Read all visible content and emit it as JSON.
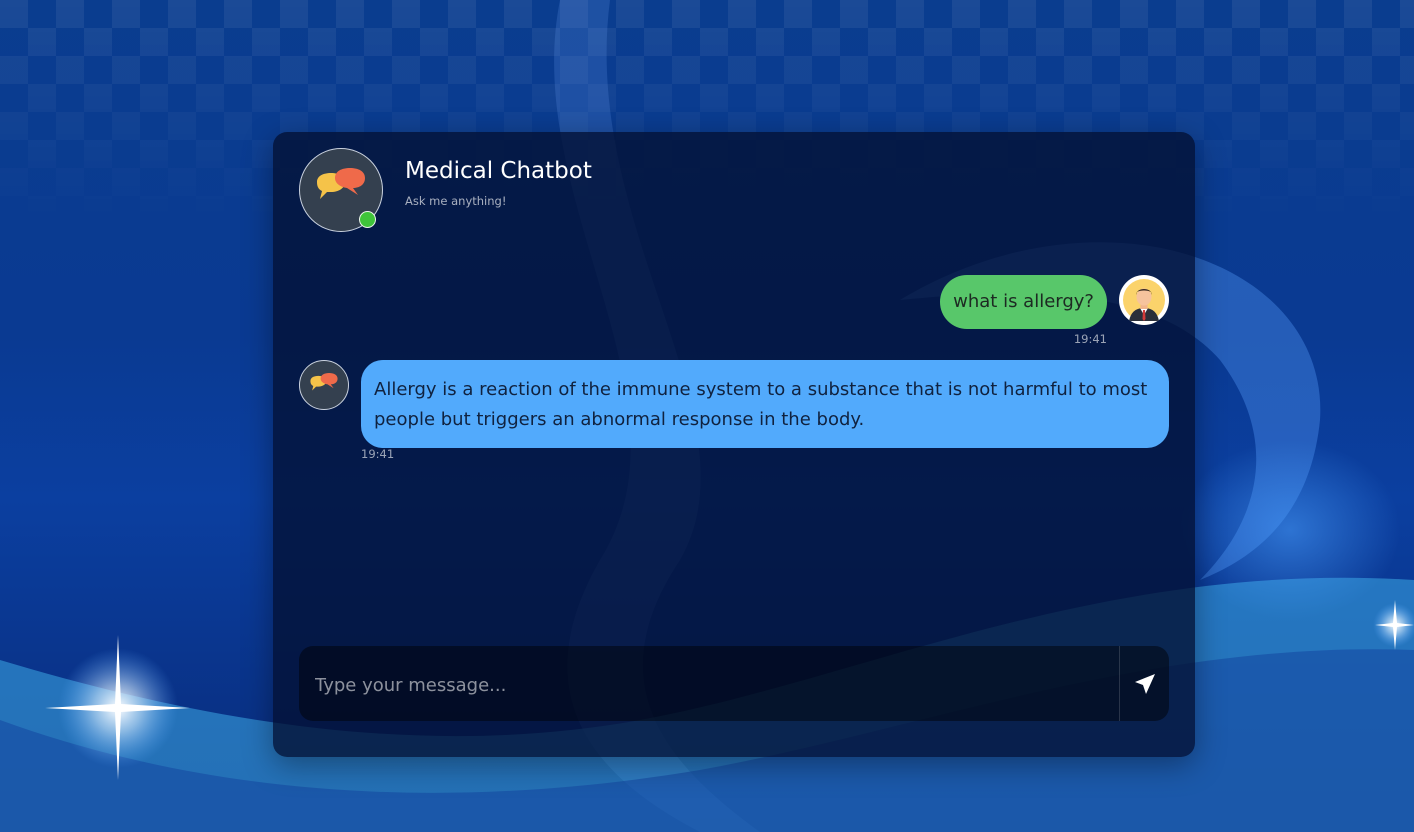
{
  "header": {
    "bot_name": "Medical Chatbot",
    "tagline": "Ask me anything!",
    "status": "online"
  },
  "messages": [
    {
      "sender": "user",
      "text": "what is allergy?",
      "time": "19:41"
    },
    {
      "sender": "bot",
      "text": "Allergy is a reaction of the immune system to a substance that is not harmful to most people but triggers an abnormal response in the body.",
      "time": "19:41"
    }
  ],
  "composer": {
    "placeholder": "Type your message...",
    "value": "",
    "send_icon": "send-icon"
  },
  "icons": {
    "bot_avatar": "speech-bubbles-icon",
    "user_avatar": "user-avatar-icon",
    "status_dot": "online-dot-icon"
  },
  "colors": {
    "user_bubble": "#58c76a",
    "bot_bubble": "#52aafc",
    "online": "#3fc43a",
    "background": "#0a3d8f"
  }
}
